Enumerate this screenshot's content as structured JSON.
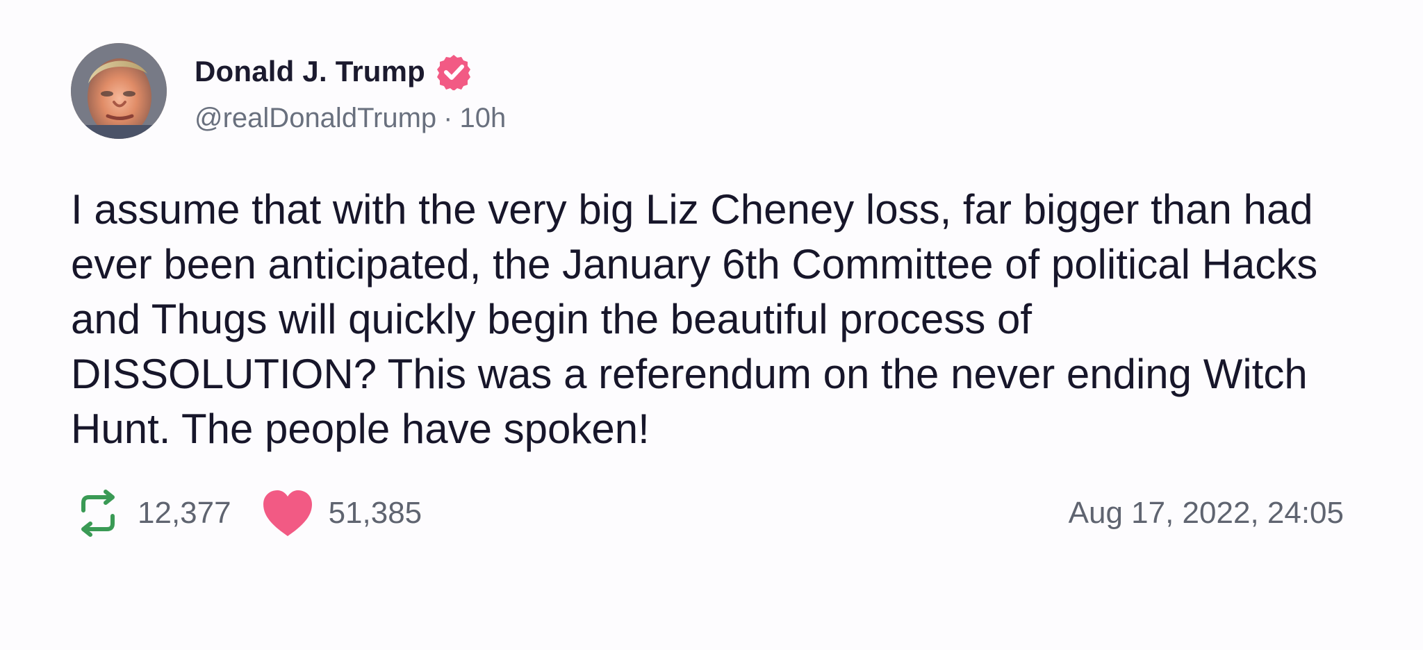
{
  "post": {
    "author": {
      "name": "Donald J. Trump",
      "handle": "@realDonaldTrump",
      "time_ago": "10h",
      "separator": "·",
      "verified": true,
      "verified_color": "#f25a84"
    },
    "text": "I assume that with the very big Liz Cheney loss, far bigger than had ever been anticipated, the January 6th Committee of political Hacks and Thugs will quickly begin the beautiful process of DISSOLUTION? This was a referendum on the never ending Witch Hunt. The people have spoken!",
    "stats": {
      "retweets": "12,377",
      "likes": "51,385"
    },
    "timestamp": "Aug 17, 2022, 24:05",
    "colors": {
      "retweet_icon": "#3a9a55",
      "heart_icon": "#f25a84",
      "name_text": "#1b1a2e",
      "muted_text": "#69707e"
    }
  },
  "icons": {
    "avatar": "profile-photo",
    "verified": "verified-badge-icon",
    "retweet": "retweet-icon",
    "like": "heart-icon"
  }
}
